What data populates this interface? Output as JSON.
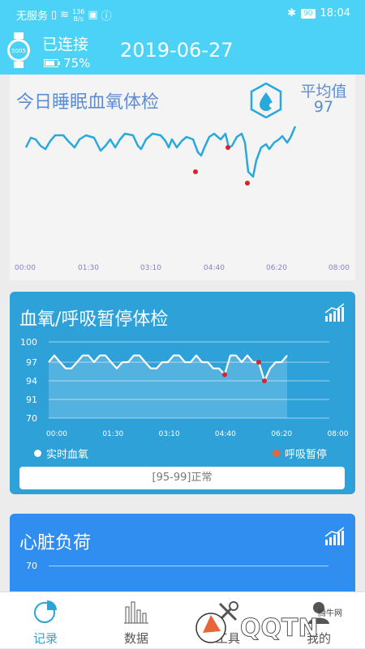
{
  "status_bar": {
    "carrier": "无服务",
    "speed_top": "136",
    "speed_unit": "B/s",
    "battery": "90",
    "time": "18:04"
  },
  "header": {
    "device_label": "5005",
    "connection": "已连接",
    "battery_pct": "75%",
    "date": "2019-06-27"
  },
  "sleep_card": {
    "title": "今日睡眠血氧体检",
    "avg_label": "平均值",
    "avg_value": "97",
    "x_ticks": [
      "00:00",
      "01:30",
      "03:10",
      "04:40",
      "06:20",
      "08:00"
    ]
  },
  "spo2_card": {
    "title": "血氧/呼吸暂停体检",
    "legend_realtime": "实时血氧",
    "legend_apnea": "呼吸暂停",
    "range_text": "[95-99]正常",
    "chart_data": {
      "type": "line",
      "y_ticks": [
        "100",
        "97",
        "94",
        "91",
        "70"
      ],
      "x_ticks": [
        "00:00",
        "01:30",
        "03:10",
        "04:40",
        "06:20",
        "08:00"
      ],
      "series": [
        {
          "name": "实时血氧",
          "values": [
            97,
            98,
            97,
            96,
            96,
            97,
            98,
            98,
            97,
            98,
            98,
            97,
            96,
            97,
            97,
            98,
            98,
            97,
            96,
            96,
            97,
            97,
            98,
            98,
            97,
            97,
            98,
            97,
            97,
            96,
            96,
            95,
            98,
            98,
            97,
            98,
            97,
            97,
            94,
            96,
            97,
            97,
            98
          ]
        },
        {
          "name": "呼吸暂停",
          "points": [
            [
              31,
              95
            ],
            [
              37,
              97
            ],
            [
              38,
              94
            ]
          ]
        }
      ]
    }
  },
  "heart_card": {
    "title": "心脏负荷",
    "y_tick": "70"
  },
  "tabs": [
    {
      "label": "记录",
      "icon": "pie-chart-icon"
    },
    {
      "label": "数据",
      "icon": "bar-chart-icon"
    },
    {
      "label": "工具",
      "icon": "tools-icon"
    },
    {
      "label": "我的",
      "icon": "person-icon"
    }
  ],
  "watermark": {
    "text": "腾牛网",
    "logo": "QQTN"
  },
  "colors": {
    "accent": "#4dd2f7",
    "card_blue": "#2ea1d9",
    "heart_blue": "#2f8ef0",
    "apnea_red": "#d9222a",
    "line": "#2aa8dc"
  }
}
